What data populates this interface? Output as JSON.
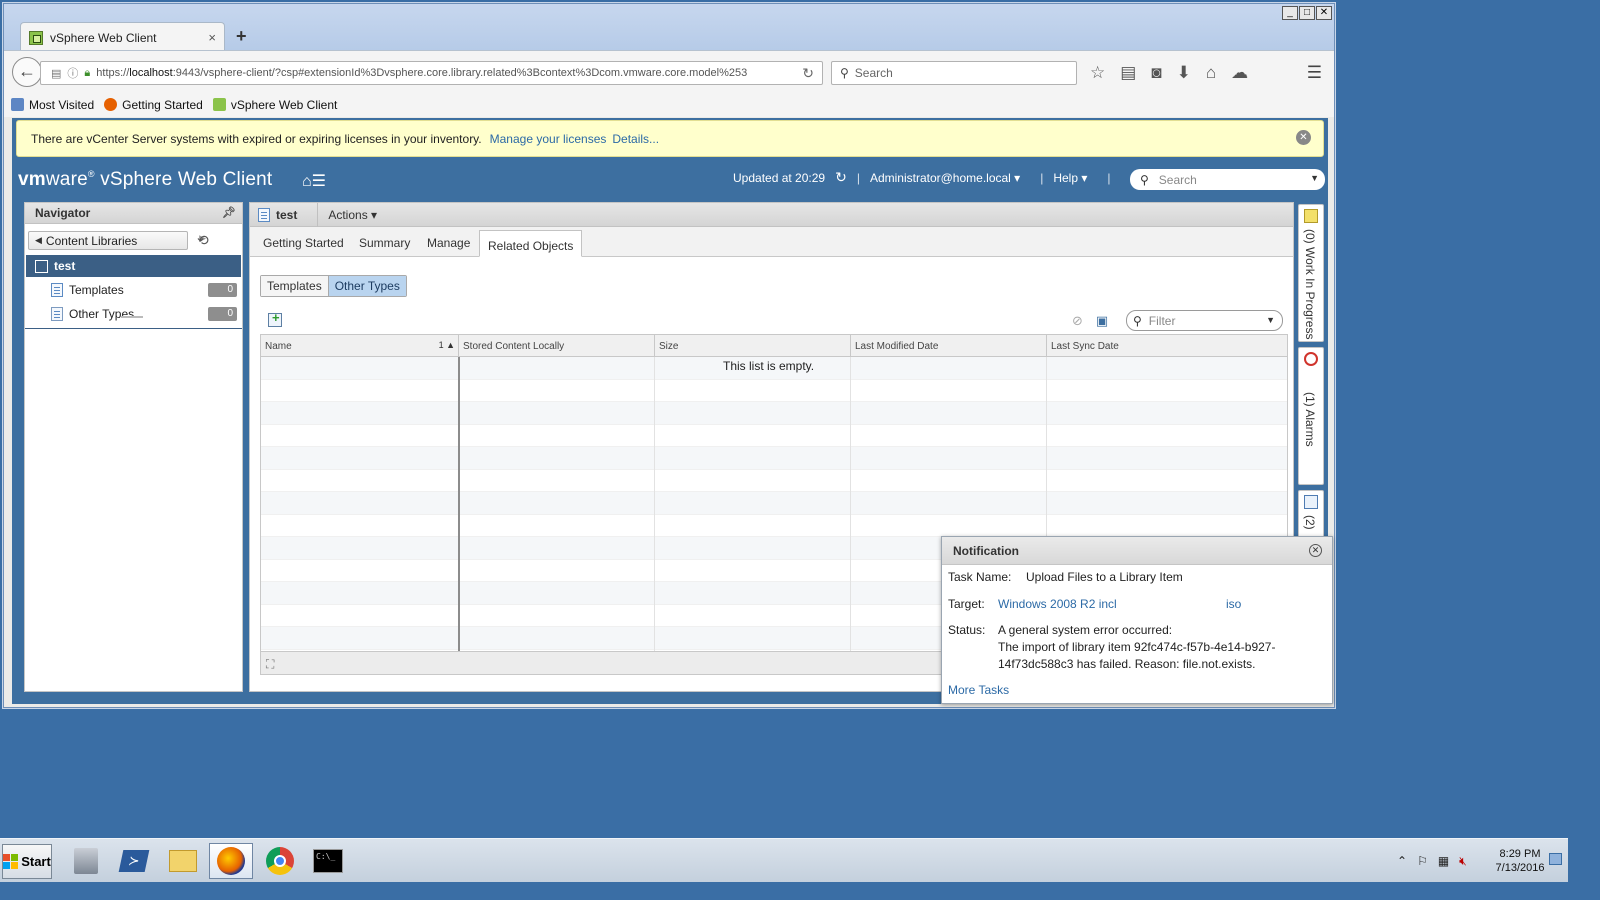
{
  "browser": {
    "tab_title": "vSphere Web Client",
    "tab_close": "×",
    "new_tab": "+",
    "window_buttons": [
      "_",
      "□",
      "✕"
    ],
    "url_scheme": "https://",
    "url_host": "localhost",
    "url_rest": ":9443/vsphere-client/?csp#extensionId%3Dvsphere.core.library.related%3Bcontext%3Dcom.vmware.core.model%253",
    "search_placeholder": "Search",
    "bookmarks": [
      "Most Visited",
      "Getting Started",
      "vSphere Web Client"
    ]
  },
  "banner": {
    "message": "There are vCenter Server systems with expired or expiring licenses in your inventory.",
    "link1": "Manage your licenses",
    "link2": "Details..."
  },
  "header": {
    "logo_vm": "vm",
    "logo_ware": "ware",
    "product": "vSphere Web Client",
    "updated": "Updated at 20:29",
    "user": "Administrator@home.local",
    "help": "Help",
    "search_placeholder": "Search"
  },
  "navigator": {
    "title": "Navigator",
    "breadcrumb": "Content Libraries",
    "selected": "test",
    "items": [
      {
        "label": "Templates",
        "count": "0"
      },
      {
        "label": "Other Types",
        "count": "0"
      }
    ]
  },
  "main": {
    "title": "test",
    "actions": "Actions",
    "tabs": [
      "Getting Started",
      "Summary",
      "Manage",
      "Related Objects"
    ],
    "active_tab": "Related Objects",
    "segments": [
      "Templates",
      "Other Types"
    ],
    "active_segment": "Other Types",
    "filter_placeholder": "Filter",
    "columns": [
      "Name",
      "Stored Content Locally",
      "Size",
      "Last Modified Date",
      "Last Sync Date"
    ],
    "sort_indicator": "1 ▲",
    "empty_message": "This list is empty."
  },
  "right_panels": [
    {
      "label": "(0)  Work In Progress"
    },
    {
      "label": "(1)  Alarms"
    },
    {
      "label": "(2)"
    }
  ],
  "notification": {
    "title": "Notification",
    "task_name_label": "Task Name:",
    "task_name": "Upload Files to a Library Item",
    "target_label": "Target:",
    "target_link": "Windows 2008 R2 incl",
    "target_link2": "iso",
    "status_label": "Status:",
    "status_line1": "A general system error occurred:",
    "status_line2": "The import of library item 92fc474c-f57b-4e14-b927-",
    "status_line3": "14f73dc588c3 has failed. Reason: file.not.exists.",
    "more_tasks": "More Tasks"
  },
  "taskbar": {
    "start": "Start",
    "time": "8:29 PM",
    "date": "7/13/2016"
  },
  "colors": {
    "desktop": "#3a6ea5",
    "vsphere_header": "#3d6fa0",
    "selected_row": "#3b5f85",
    "link": "#2c6aa6",
    "banner_bg": "#ffffcc"
  }
}
